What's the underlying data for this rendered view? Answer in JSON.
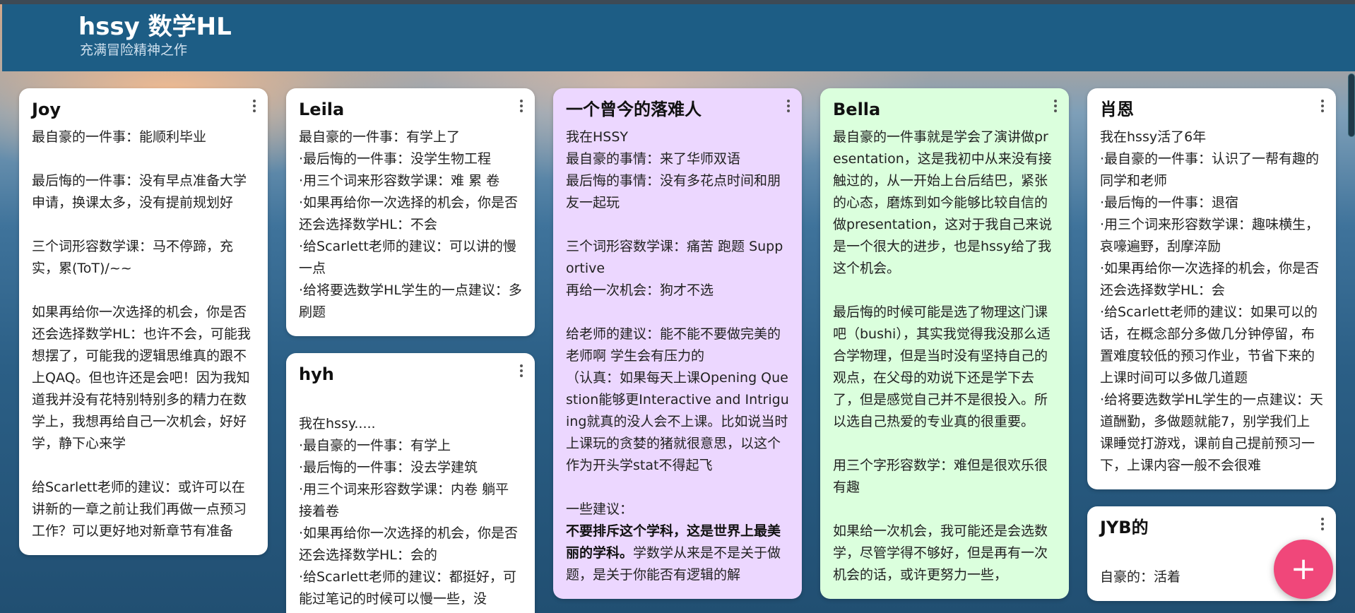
{
  "header": {
    "title": "hssy 数学HL",
    "subtitle": "充满冒险精神之作"
  },
  "notes": {
    "joy": {
      "title": "Joy",
      "body": "最自豪的一件事：能顺利毕业\n\n最后悔的一件事：没有早点准备大学申请，换课太多，没有提前规划好\n\n三个词形容数学课：马不停蹄，充实，累(ToT)/~~\n\n如果再给你一次选择的机会，你是否还会选择数学HL：也许不会，可能我想摆了，可能我的逻辑思维真的跟不上QAQ。但也许还是会吧！因为我知道我并没有花特别特别多的精力在数学上，我想再给自己一次机会，好好学，静下心来学\n\n给Scarlett老师的建议：或许可以在讲新的一章之前让我们再做一点预习工作？可以更好地对新章节有准备"
    },
    "leila": {
      "title": "Leila",
      "body": "最自豪的一件事：有学上了\n·最后悔的一件事：没学生物工程\n·用三个词来形容数学课：难 累 卷\n·如果再给你一次选择的机会，你是否还会选择数学HL：不会\n·给Scarlett老师的建议：可以讲的慢一点\n·给将要选数学HL学生的一点建议：多刷题"
    },
    "hyh": {
      "title": "hyh",
      "body": "\n我在hssy.....\n·最自豪的一件事：有学上\n·最后悔的一件事：没去学建筑\n·用三个词来形容数学课：内卷 躺平 接着卷\n·如果再给你一次选择的机会，你是否还会选择数学HL：会的\n·给Scarlett老师的建议：都挺好，可能过笔记的时候可以慢一些，没"
    },
    "fallen": {
      "title": "一个曾今的落难人",
      "body": "我在HSSY\n最自豪的事情：来了华师双语\n最后悔的事情：没有多花点时间和朋友一起玩\n\n三个词形容数学课：痛苦 跑题 Supportive\n再给一次机会：狗才不选\n\n给老师的建议：能不能不要做完美的老师啊 学生会有压力的\n（认真：如果每天上课Opening Question能够更Interactive and Intriguing就真的没人会不上课。比如说当时上课玩的贪婪的猪就很意思，以这个作为开头学stat不得起飞\n\n一些建议：",
      "bold": "不要排斥这个学科，这是世界上最美丽的学科。",
      "tail": "学数学从来是不是关于做题，是关于你能否有逻辑的解"
    },
    "bella": {
      "title": "Bella",
      "body": "最自豪的一件事就是学会了演讲做presentation，这是我初中从来没有接触过的，从一开始上台后结巴，紧张的心态，磨炼到如今能够比较自信的做presentation，这对于我自己来说是一个很大的进步，也是hssy给了我这个机会。\n\n最后悔的时候可能是选了物理这门课吧（bushi），其实我觉得我没那么适合学物理，但是当时没有坚持自己的观点，在父母的劝说下还是学下去了，但是感觉自己并不是很投入。所以选自己热爱的专业真的很重要。\n\n用三个字形容数学：难但是很欢乐很有趣\n\n如果给一次机会，我可能还是会选数学，尽管学得不够好，但是再有一次机会的话，或许更努力一些，"
    },
    "xiaoen": {
      "title": "肖恩",
      "body": "我在hssy活了6年\n·最自豪的一件事：认识了一帮有趣的同学和老师\n·最后悔的一件事：退宿\n·用三个词来形容数学课：趣味横生，哀嚎遍野，刮摩淬励\n·如果再给你一次选择的机会，你是否还会选择数学HL：会\n·给Scarlett老师的建议：如果可以的话，在概念部分多做几分钟停留，布置难度较低的预习作业，节省下来的上课时间可以多做几道题\n·给将要选数学HL学生的一点建议：天道酬勤，多做题就能7，别学我们上课睡觉打游戏，课前自己提前预习一下，上课内容一般不会很难"
    },
    "jyb": {
      "title": "JYB的",
      "body": "\n自豪的：活着"
    }
  },
  "fab": {
    "label": "+"
  },
  "colors": {
    "header": "#1d5d85",
    "note_white": "#ffffff",
    "note_purple": "#ecd7ff",
    "note_green": "#dbffdd",
    "fab": "#f0477a"
  }
}
